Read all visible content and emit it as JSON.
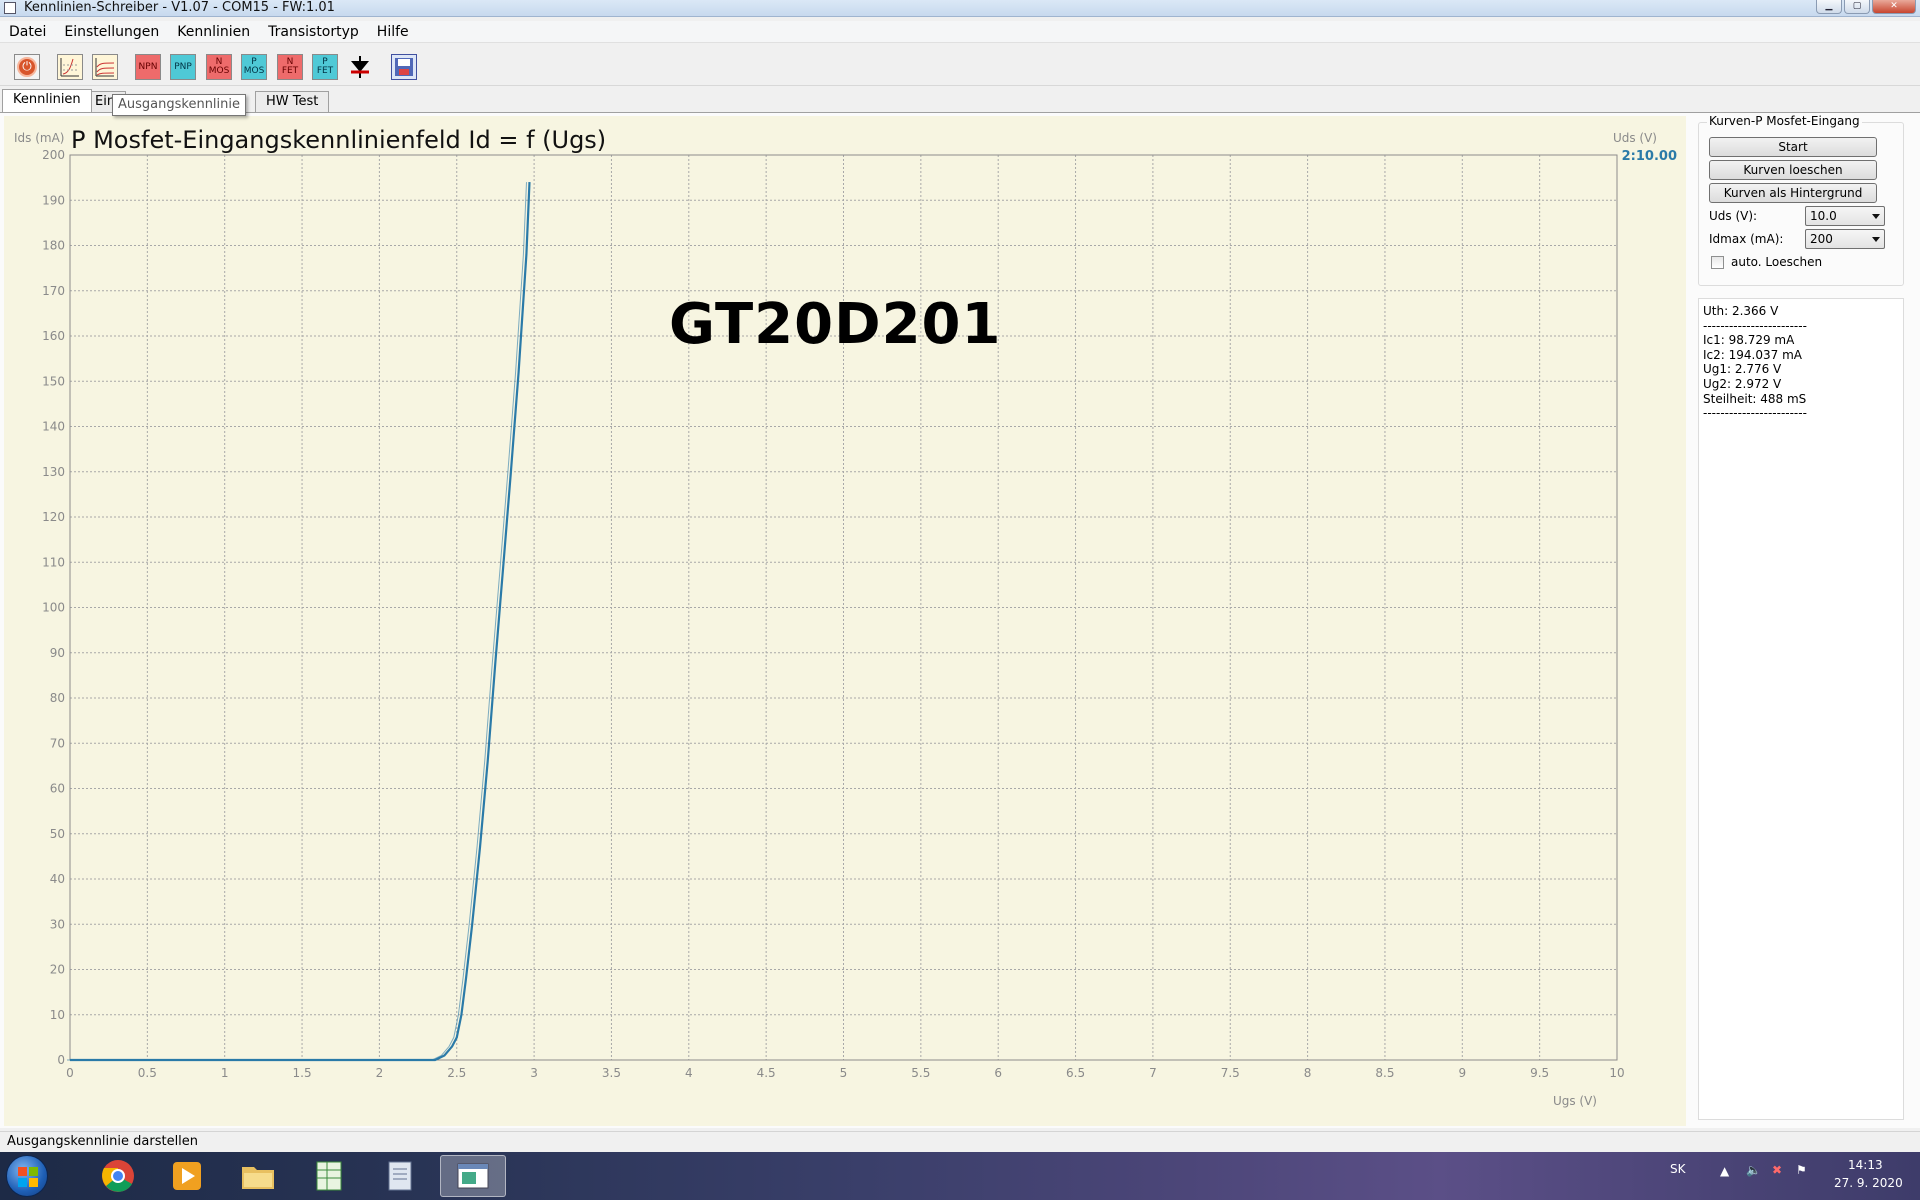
{
  "window": {
    "title": "Kennlinien-Schreiber - V1.07 - COM15 - FW:1.01"
  },
  "menu": [
    "Datei",
    "Einstellungen",
    "Kennlinien",
    "Transistortyp",
    "Hilfe"
  ],
  "toolbar": {
    "npn": "NPN",
    "pnp": "PNP",
    "nmos": [
      "N",
      "MOS"
    ],
    "pmos": [
      "P",
      "MOS"
    ],
    "nfet": [
      "N",
      "FET"
    ],
    "pfet": [
      "P",
      "FET"
    ],
    "tooltip": "Ausgangskennlinie"
  },
  "tabs": [
    "Kennlinien",
    "Ein",
    "HW Test"
  ],
  "plot": {
    "title": "P Mosfet-Eingangskennlinienfeld Id = f (Ugs)",
    "part_label": "GT20D201",
    "uds_readout": "2:10.00",
    "curve_color": "#2a7aa8",
    "readout_color": "#2a7aa8",
    "grid_color": "#a8a8a8"
  },
  "chart_data": {
    "type": "line",
    "title": "P Mosfet-Eingangskennlinienfeld Id = f (Ugs)",
    "xlabel": "Ugs (V)",
    "ylabel": "Ids (mA)",
    "y2label": "Uds (V)",
    "xlim": [
      0,
      10
    ],
    "ylim": [
      0,
      200
    ],
    "xticks": [
      "0",
      "0.5",
      "1",
      "1.5",
      "2",
      "2.5",
      "3",
      "3.5",
      "4",
      "4.5",
      "5",
      "5.5",
      "6",
      "6.5",
      "7",
      "7.5",
      "8",
      "8.5",
      "9",
      "9.5",
      "10"
    ],
    "yticks": [
      "0",
      "10",
      "20",
      "30",
      "40",
      "50",
      "60",
      "70",
      "80",
      "90",
      "100",
      "110",
      "120",
      "130",
      "140",
      "150",
      "160",
      "170",
      "180",
      "190",
      "200"
    ],
    "grid": true,
    "series": [
      {
        "x": [
          0,
          2.0,
          2.36,
          2.42,
          2.47,
          2.5,
          2.53,
          2.56,
          2.6,
          2.65,
          2.7,
          2.75,
          2.8,
          2.85,
          2.9,
          2.95,
          2.97
        ],
        "y": [
          0,
          0,
          0,
          1,
          3,
          5,
          10,
          18,
          30,
          47,
          66,
          88,
          109,
          130,
          152,
          178,
          194
        ]
      }
    ]
  },
  "side": {
    "group_title": "Kurven-P Mosfet-Eingang",
    "start_button": "Start",
    "clear_button": "Kurven loeschen",
    "background_button": "Kurven als Hintergrund",
    "uds_label": "Uds (V):",
    "uds_value": "10.0",
    "idmax_label": "Idmax (mA):",
    "idmax_value": "200",
    "auto_clear_label": "auto. Loeschen",
    "results": [
      "Uth: 2.366 V",
      "------------------------",
      "Ic1: 98.729 mA",
      "Ic2: 194.037 mA",
      "Ug1: 2.776 V",
      "Ug2: 2.972 V",
      "Steilheit: 488 mS",
      "------------------------"
    ]
  },
  "status": "Ausgangskennlinie darstellen",
  "taskbar": {
    "language": "SK",
    "time": "14:13",
    "date": "27. 9. 2020"
  }
}
